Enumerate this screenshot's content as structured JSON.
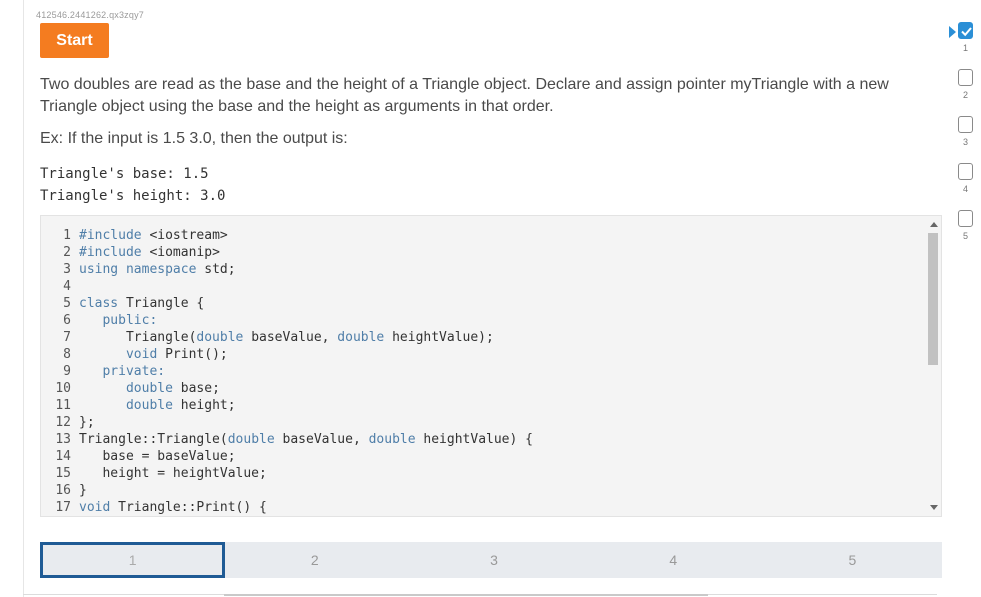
{
  "activity": {
    "id": "412546.2441262.qx3zqy7",
    "start_label": "Start"
  },
  "prompt": {
    "text": "Two doubles are read as the base and the height of a Triangle object. Declare and assign pointer myTriangle with a new Triangle object using the base and the height as arguments in that order.",
    "example": "Ex: If the input is 1.5 3.0, then the output is:",
    "output_lines": [
      "Triangle's base: 1.5",
      "Triangle's height: 3.0"
    ]
  },
  "editor": {
    "lines": [
      {
        "n": "1",
        "code": "#include <iostream>"
      },
      {
        "n": "2",
        "code": "#include <iomanip>"
      },
      {
        "n": "3",
        "code": "using namespace std;"
      },
      {
        "n": "4",
        "code": ""
      },
      {
        "n": "5",
        "code": "class Triangle {"
      },
      {
        "n": "6",
        "code": "   public:"
      },
      {
        "n": "7",
        "code": "      Triangle(double baseValue, double heightValue);"
      },
      {
        "n": "8",
        "code": "      void Print();"
      },
      {
        "n": "9",
        "code": "   private:"
      },
      {
        "n": "10",
        "code": "      double base;"
      },
      {
        "n": "11",
        "code": "      double height;"
      },
      {
        "n": "12",
        "code": "};"
      },
      {
        "n": "13",
        "code": "Triangle::Triangle(double baseValue, double heightValue) {"
      },
      {
        "n": "14",
        "code": "   base = baseValue;"
      },
      {
        "n": "15",
        "code": "   height = heightValue;"
      },
      {
        "n": "16",
        "code": "}"
      },
      {
        "n": "17",
        "code": "void Triangle::Print() {"
      }
    ]
  },
  "levels": [
    "1",
    "2",
    "3",
    "4",
    "5"
  ],
  "active_level": "1",
  "steps": [
    {
      "label": "1",
      "done": true
    },
    {
      "label": "2",
      "done": false
    },
    {
      "label": "3",
      "done": false
    },
    {
      "label": "4",
      "done": false
    },
    {
      "label": "5",
      "done": false
    }
  ],
  "colors": {
    "accent": "#f47c20",
    "brand_blue": "#1f5b95",
    "check_blue": "#2b8fd6"
  }
}
